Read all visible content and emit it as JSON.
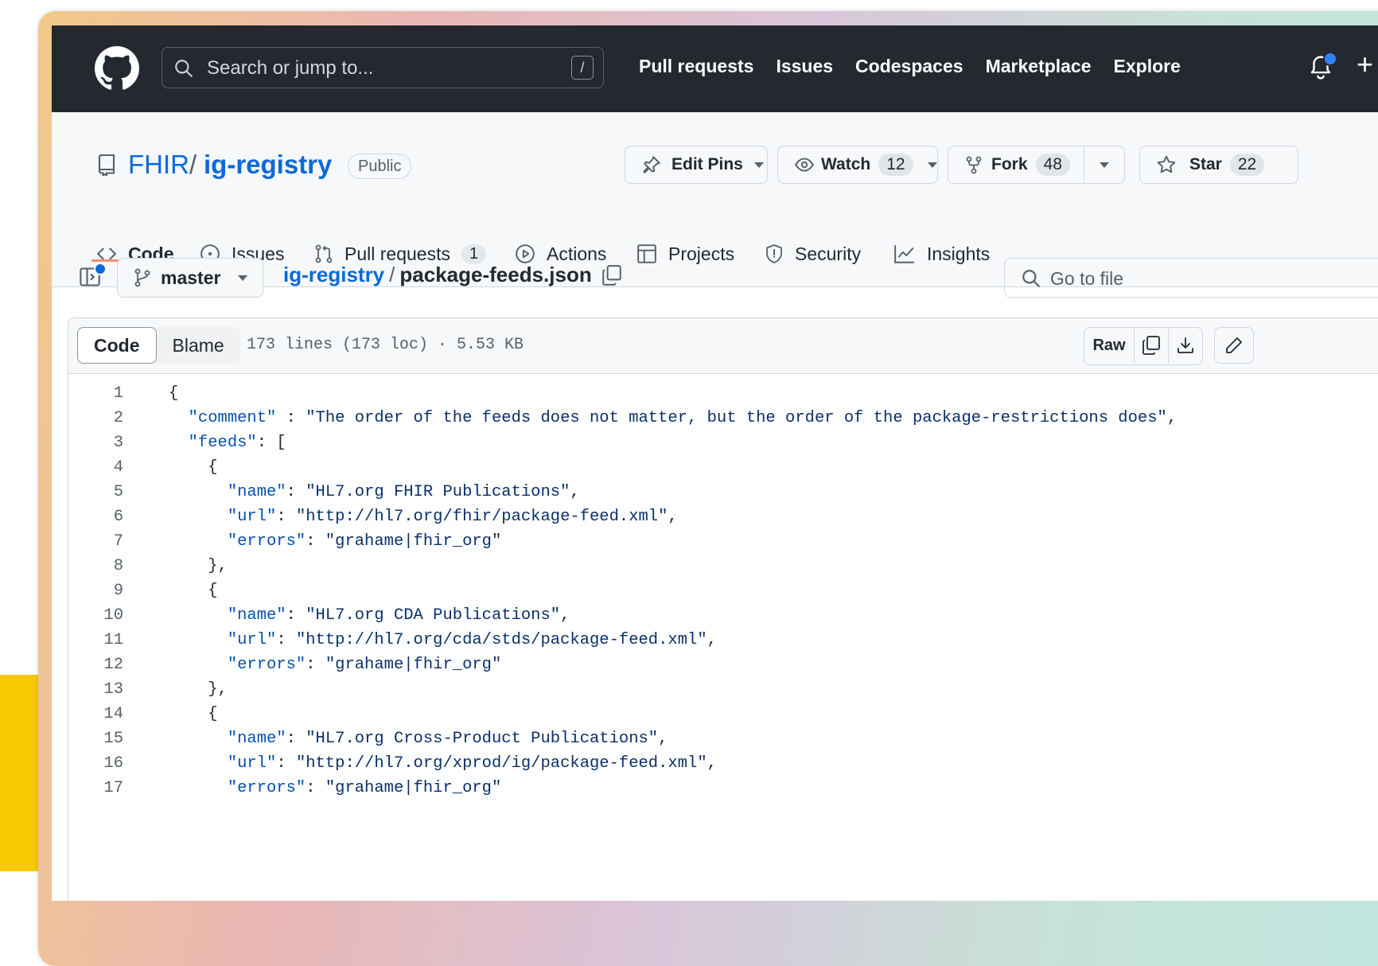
{
  "header": {
    "search_placeholder": "Search or jump to...",
    "search_shortcut": "/",
    "nav": [
      "Pull requests",
      "Issues",
      "Codespaces",
      "Marketplace",
      "Explore"
    ],
    "plus": "+"
  },
  "repo": {
    "owner": "FHIR",
    "separator": "/",
    "name": "ig-registry",
    "visibility": "Public",
    "edit_pins": "Edit Pins",
    "watch_label": "Watch",
    "watch_count": "12",
    "fork_label": "Fork",
    "fork_count": "48",
    "star_label": "Star",
    "star_count": "22"
  },
  "tabs": [
    {
      "label": "Code",
      "active": true
    },
    {
      "label": "Issues"
    },
    {
      "label": "Pull requests",
      "badge": "1"
    },
    {
      "label": "Actions"
    },
    {
      "label": "Projects"
    },
    {
      "label": "Security"
    },
    {
      "label": "Insights"
    }
  ],
  "file": {
    "branch": "master",
    "path_repo": "ig-registry",
    "path_sep": "/",
    "filename": "package-feeds.json",
    "goto_placeholder": "Go to file",
    "view_code": "Code",
    "view_blame": "Blame",
    "meta": "173 lines (173 loc) · 5.53 KB",
    "raw": "Raw"
  },
  "code_lines": [
    {
      "n": "1",
      "text": "{"
    },
    {
      "n": "2",
      "text": "  \"comment\" : \"The order of the feeds does not matter, but the order of the package-restrictions does\","
    },
    {
      "n": "3",
      "text": "  \"feeds\": ["
    },
    {
      "n": "4",
      "text": "    {"
    },
    {
      "n": "5",
      "text": "      \"name\": \"HL7.org FHIR Publications\","
    },
    {
      "n": "6",
      "text": "      \"url\": \"http://hl7.org/fhir/package-feed.xml\","
    },
    {
      "n": "7",
      "text": "      \"errors\": \"grahame|fhir_org\""
    },
    {
      "n": "8",
      "text": "    },"
    },
    {
      "n": "9",
      "text": "    {"
    },
    {
      "n": "10",
      "text": "      \"name\": \"HL7.org CDA Publications\","
    },
    {
      "n": "11",
      "text": "      \"url\": \"http://hl7.org/cda/stds/package-feed.xml\","
    },
    {
      "n": "12",
      "text": "      \"errors\": \"grahame|fhir_org\""
    },
    {
      "n": "13",
      "text": "    },"
    },
    {
      "n": "14",
      "text": "    {"
    },
    {
      "n": "15",
      "text": "      \"name\": \"HL7.org Cross-Product Publications\","
    },
    {
      "n": "16",
      "text": "      \"url\": \"http://hl7.org/xprod/ig/package-feed.xml\","
    },
    {
      "n": "17",
      "text": "      \"errors\": \"grahame|fhir_org\""
    }
  ],
  "colors": {
    "header_bg": "#24292f",
    "link": "#0969da",
    "tab_underline": "#fd8c73",
    "notification": "#2f81f7"
  }
}
